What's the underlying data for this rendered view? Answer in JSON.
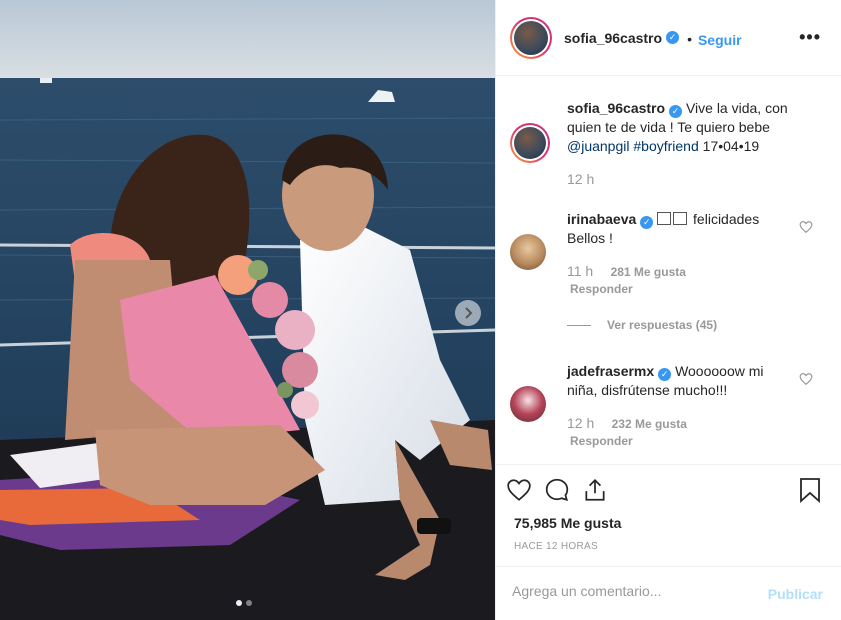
{
  "post": {
    "username": "sofia_96castro",
    "follow_label": "Seguir",
    "separator": "•",
    "more_label": "•••",
    "caption": {
      "username": "sofia_96castro",
      "text": "Vive la vida, con quien te de vida ! Te quiero bebe",
      "mention": "@juanpgil",
      "hashtag": "#boyfriend",
      "date": "17•04•19",
      "time": "12 h"
    },
    "comments": [
      {
        "username": "irinabaeva",
        "text": "felicidades Bellos !",
        "time": "11 h",
        "likes": "281 Me gusta",
        "reply_label": "Responder",
        "view_replies": "Ver respuestas (45)"
      },
      {
        "username": "jadefrasermx",
        "text": "Woooooow mi niña, disfrútense mucho!!!",
        "time": "12 h",
        "likes": "232 Me gusta",
        "reply_label": "Responder"
      }
    ],
    "likes_count": "75,985 Me gusta",
    "time_ago": "HACE 12 HORAS",
    "comment_placeholder": "Agrega un comentario...",
    "publish_label": "Publicar"
  },
  "carousel": {
    "total": 2,
    "current": 1
  },
  "colors": {
    "accent": "#3897f0",
    "publish_disabled": "#b2dffc",
    "muted": "#999999"
  }
}
